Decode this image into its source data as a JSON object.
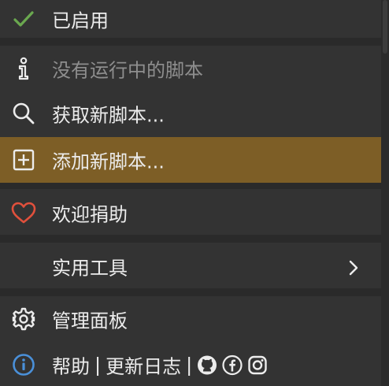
{
  "menu": {
    "enabled_label": "已启用",
    "no_scripts_label": "没有运行中的脚本",
    "get_new_label": "获取新脚本...",
    "add_new_label": "添加新脚本...",
    "donate_label": "欢迎捐助",
    "tools_label": "实用工具",
    "dashboard_label": "管理面板",
    "help_label": "帮助",
    "separator": "|",
    "changelog_label": "更新日志"
  },
  "colors": {
    "background": "#333333",
    "highlight": "#7d5e26",
    "check": "#6aa84f",
    "heart": "#e0503c",
    "info": "#4a90d9"
  },
  "icons": [
    "check-icon",
    "info-icon",
    "search-icon",
    "plus-square-icon",
    "heart-icon",
    "chevron-right-icon",
    "gear-icon",
    "info-circle-icon",
    "github-icon",
    "facebook-icon",
    "instagram-icon"
  ]
}
